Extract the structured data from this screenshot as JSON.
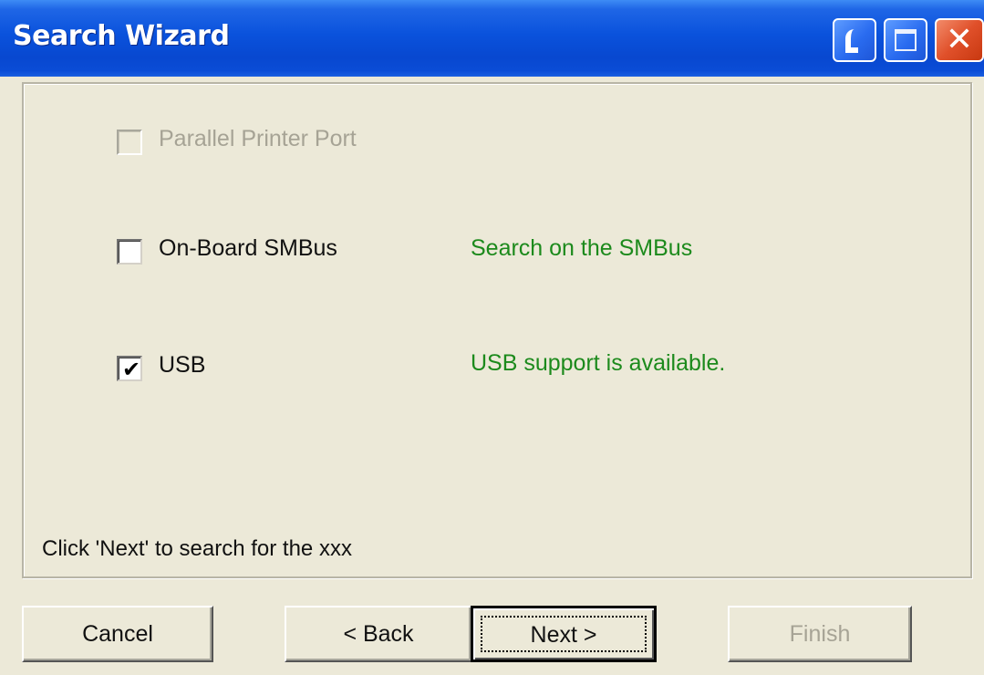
{
  "window": {
    "title": "Search Wizard"
  },
  "options": [
    {
      "label": "Parallel Printer Port",
      "checked": false,
      "enabled": false,
      "status": ""
    },
    {
      "label": "On-Board SMBus",
      "checked": false,
      "enabled": true,
      "status": "Search on the SMBus"
    },
    {
      "label": "USB",
      "checked": true,
      "enabled": true,
      "status": "USB support is available."
    }
  ],
  "hint": "Click 'Next' to search for  the xxx",
  "buttons": {
    "cancel": "Cancel",
    "back": "< Back",
    "next": "Next >",
    "finish": "Finish"
  },
  "colors": {
    "titlebar": "#0a52dc",
    "status_text": "#1c8a1c",
    "disabled_text": "#a6a395",
    "background": "#ece9d8"
  },
  "icons": {
    "checkmark": "checkmark-icon",
    "close": "close-icon",
    "minimize": "minimize-icon",
    "maximize": "maximize-icon"
  }
}
